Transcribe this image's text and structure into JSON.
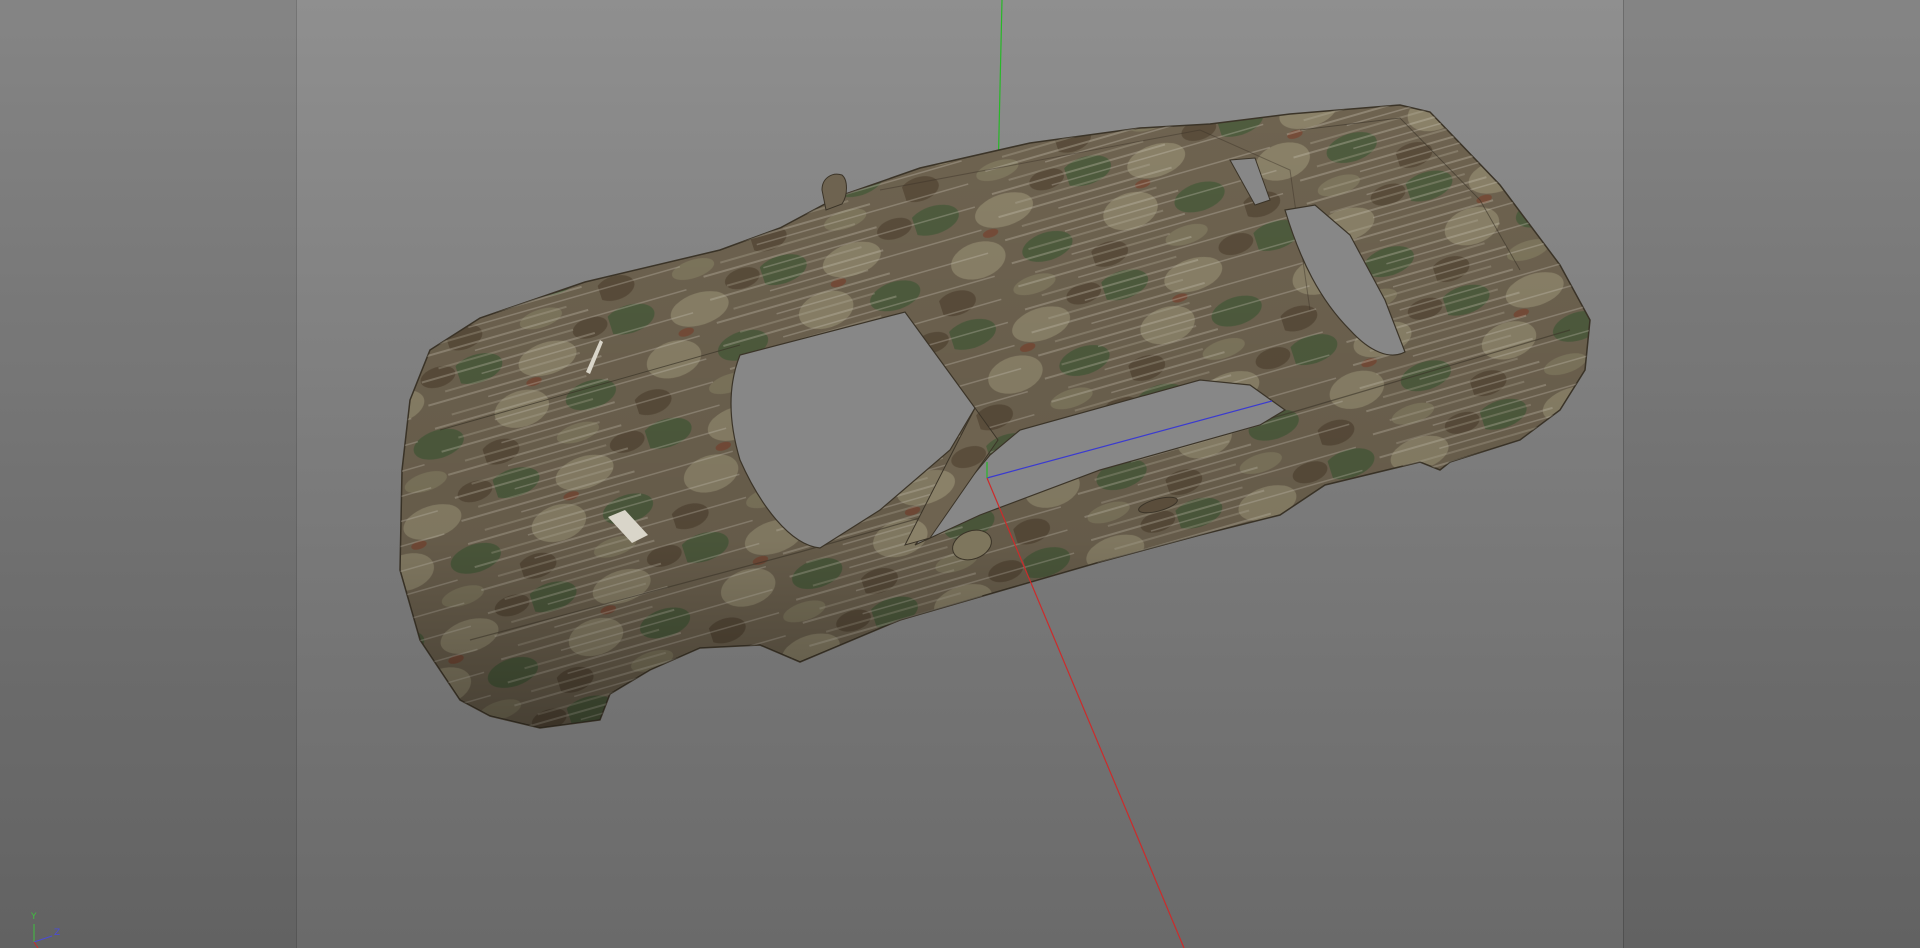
{
  "viewport": {
    "background_top": "#8f8f8f",
    "background_bottom": "#6a6a6a",
    "content": "3d-car-body-model"
  },
  "scene": {
    "model_texture": "camouflage",
    "texture_colors": [
      "#6e6350",
      "#4f5c3e",
      "#8a8168",
      "#5a4d3b",
      "#7b3a26"
    ],
    "axis_colors": {
      "x": "#cc2b2b",
      "y": "#28b828",
      "z": "#3a3ad0"
    }
  },
  "axis_gizmo": {
    "y_label": "Y",
    "z_label": "Z"
  }
}
